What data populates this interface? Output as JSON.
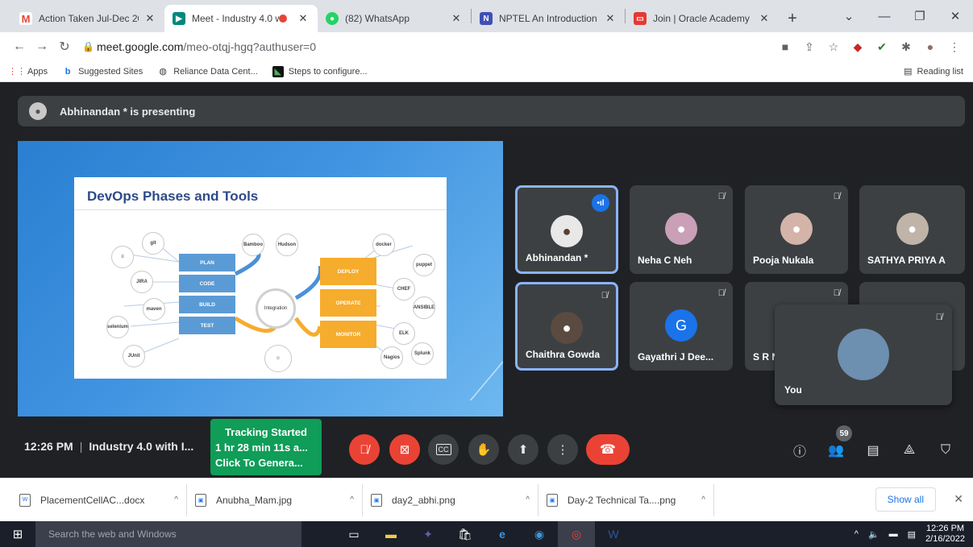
{
  "browser": {
    "tabs": [
      {
        "title": "Action Taken Jul-Dec 202",
        "icon": "gmail-icon",
        "icon_color": "#ea4335",
        "active": false
      },
      {
        "title": "Meet - Industry 4.0 w",
        "icon": "meet-icon",
        "icon_color": "#00897b",
        "active": true
      },
      {
        "title": "(82) WhatsApp",
        "icon": "whatsapp-icon",
        "icon_color": "#25d366",
        "active": false
      },
      {
        "title": "NPTEL An Introduction To",
        "icon": "nptel-icon",
        "icon_color": "#3f51b5",
        "active": false
      },
      {
        "title": "Join | Oracle Academy",
        "icon": "oracle-icon",
        "icon_color": "#e53935",
        "active": false
      }
    ],
    "new_tab": "+",
    "url_host": "meet.google.com",
    "url_path": "/meo-otqj-hgq?authuser=0",
    "bookmarks": [
      {
        "label": "Apps",
        "icon": "apps-icon"
      },
      {
        "label": "Suggested Sites",
        "icon": "bing-icon"
      },
      {
        "label": "Reliance Data Cent...",
        "icon": "globe-icon"
      },
      {
        "label": "Steps to configure...",
        "icon": "bookmark-icon"
      }
    ],
    "reading_list": "Reading list"
  },
  "meet": {
    "presenter_banner": "Abhinandan * is presenting",
    "slide": {
      "title": "DevOps Phases and Tools",
      "phases_left": [
        "PLAN",
        "CODE",
        "BUILD",
        "TEST"
      ],
      "phases_right": [
        "DEPLOY",
        "OPERATE",
        "MONITOR"
      ],
      "hub": "Integration",
      "tools": [
        "git",
        "JIRA",
        "Bamboo",
        "Hudson",
        "docker",
        "puppet",
        "CHEF",
        "ANSIBLE",
        "Nagios",
        "Splunk",
        "JUnit",
        "selenium",
        "maven",
        "ELK"
      ]
    },
    "participants": [
      {
        "name": "Abhinandan *",
        "speaking": true,
        "muted": false,
        "avatar_color": "#e8e8e8"
      },
      {
        "name": "Neha C Neh",
        "speaking": false,
        "muted": true,
        "avatar_color": "#c9a0b8"
      },
      {
        "name": "Pooja Nukala",
        "speaking": false,
        "muted": true,
        "avatar_color": "#d4b4a8"
      },
      {
        "name": "SATHYA PRIYA A",
        "speaking": false,
        "muted": false,
        "avatar_color": "#c0b4a8"
      },
      {
        "name": "Chaithra Gowda",
        "speaking": false,
        "muted": true,
        "avatar_color": "#5a4a40",
        "highlighted": true
      },
      {
        "name": "Gayathri J Dee...",
        "speaking": false,
        "muted": true,
        "avatar_letter": "G",
        "avatar_color": "#1a73e8"
      },
      {
        "name": "S R N",
        "speaking": false,
        "muted": true,
        "avatar_color": "#3c4043"
      }
    ],
    "self": {
      "name": "You"
    },
    "time": "12:26 PM",
    "meeting_title": "Industry 4.0 with I...",
    "tracking": {
      "line1": "Tracking Started",
      "line2": "1 hr 28 min 11s a...",
      "line3": "Click To Genera..."
    },
    "participant_count": "59",
    "cc_label": "CC"
  },
  "downloads": [
    {
      "name": "PlacementCellAC...docx"
    },
    {
      "name": "Anubha_Mam.jpg"
    },
    {
      "name": "day2_abhi.png"
    },
    {
      "name": "Day-2 Technical Ta....png"
    }
  ],
  "show_all": "Show all",
  "taskbar": {
    "search_placeholder": "Search the web and Windows",
    "time": "12:26 PM",
    "date": "2/16/2022"
  },
  "colors": {
    "accent_blue": "#1a73e8",
    "meet_red": "#ea4335",
    "tracking_green": "#0f9d58",
    "meet_bg": "#202124"
  }
}
